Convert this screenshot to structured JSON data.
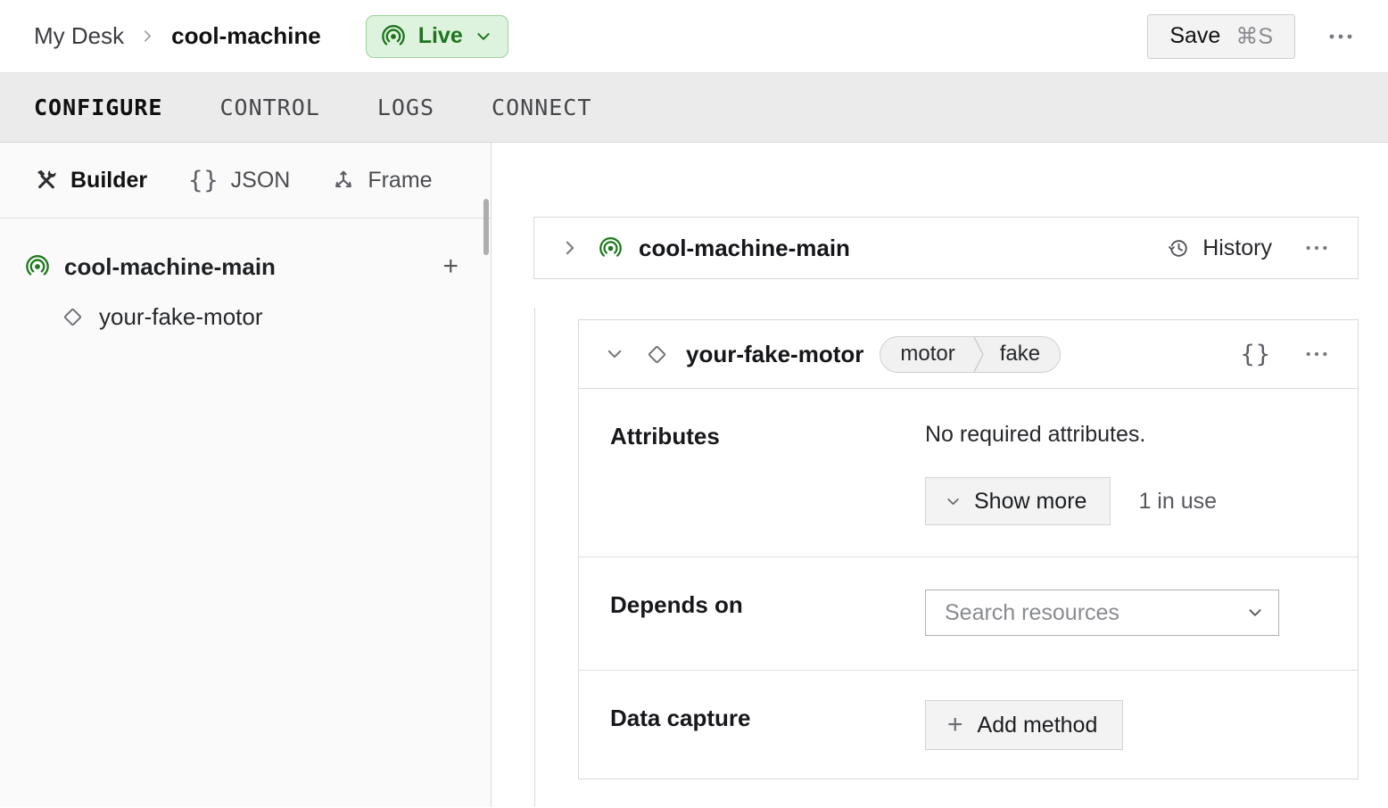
{
  "header": {
    "breadcrumb": {
      "parent": "My Desk",
      "current": "cool-machine"
    },
    "live_button": {
      "label": "Live"
    },
    "save_button": {
      "label": "Save",
      "shortcut": "⌘S"
    }
  },
  "tabs": {
    "configure": "CONFIGURE",
    "control": "CONTROL",
    "logs": "LOGS",
    "connect": "CONNECT"
  },
  "sidebar": {
    "modes": {
      "builder": "Builder",
      "json": "JSON",
      "frame": "Frame"
    },
    "tree": {
      "part": {
        "label": "cool-machine-main"
      },
      "component": {
        "label": "your-fake-motor"
      }
    }
  },
  "main": {
    "part_card": {
      "title": "cool-machine-main",
      "history_label": "History"
    },
    "component_card": {
      "title": "your-fake-motor",
      "badge": {
        "type": "motor",
        "model": "fake"
      },
      "attributes": {
        "label": "Attributes",
        "empty_text": "No required attributes.",
        "show_more_label": "Show more",
        "in_use_text": "1 in use"
      },
      "depends_on": {
        "label": "Depends on",
        "placeholder": "Search resources"
      },
      "data_capture": {
        "label": "Data capture",
        "add_method_label": "Add method"
      }
    }
  },
  "icons": {
    "braces": "{}",
    "plus": "+"
  },
  "colors": {
    "live_bg": "#ddf3dd",
    "live_border": "#9bd29b",
    "live_text": "#1e741e",
    "brand_green": "#1f7a1f",
    "tabbar_bg": "#ebebeb",
    "sidebar_bg": "#fafafa",
    "border": "#d9d9d9"
  }
}
